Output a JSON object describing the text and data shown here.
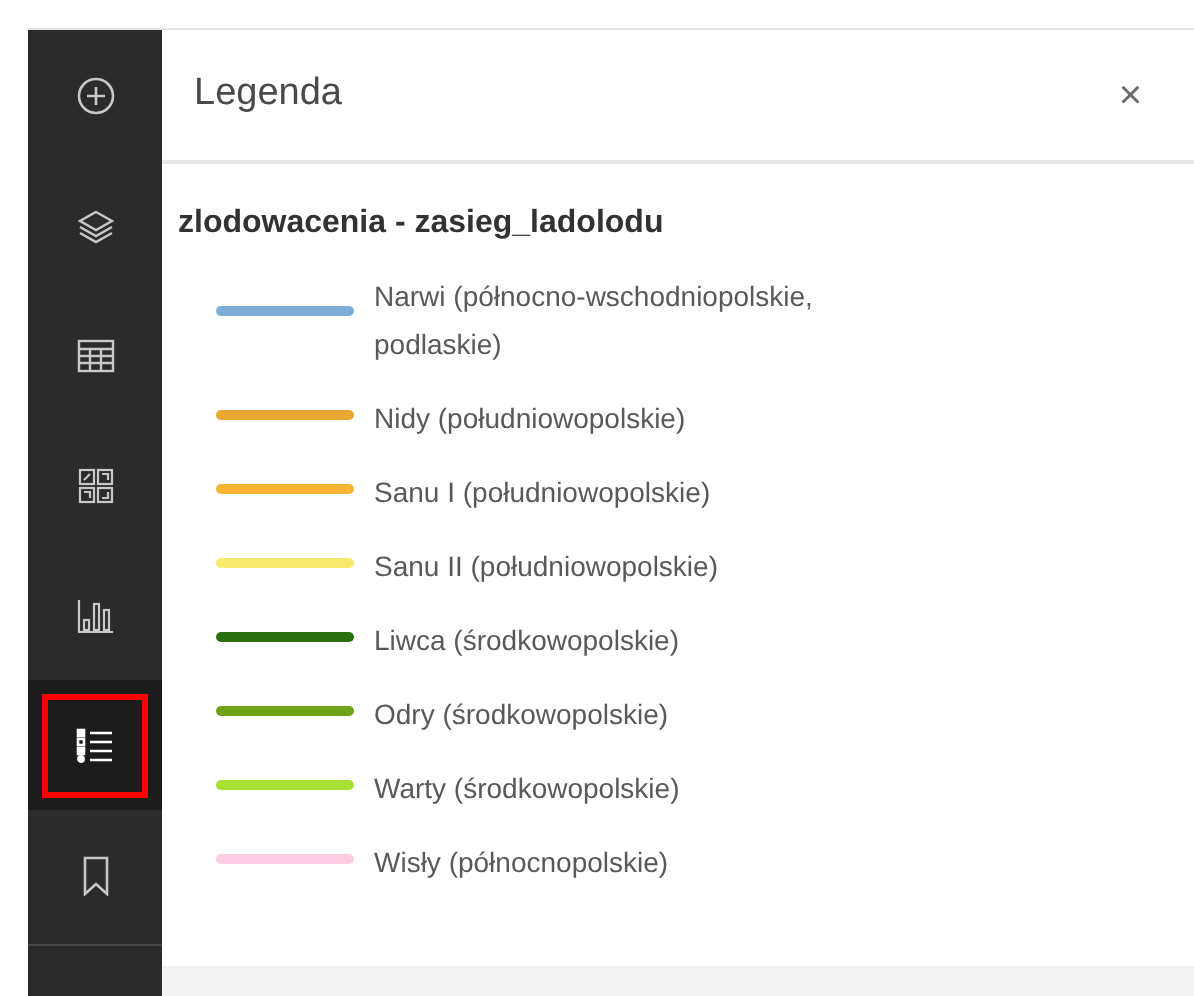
{
  "sidebar": {
    "items": [
      {
        "kind": "add",
        "selected": false
      },
      {
        "kind": "layers",
        "selected": false
      },
      {
        "kind": "table",
        "selected": false
      },
      {
        "kind": "grid",
        "selected": false
      },
      {
        "kind": "chart",
        "selected": false
      },
      {
        "kind": "legend",
        "selected": true
      },
      {
        "kind": "bookmark",
        "selected": false
      }
    ]
  },
  "panel": {
    "title": "Legenda",
    "close": "×"
  },
  "legend": {
    "layer_title": "zlodowacenia - zasieg_ladolodu",
    "items": [
      {
        "label": "Narwi (północno-wschodniopolskie, podlaskie)",
        "color": "#7eaed8"
      },
      {
        "label": "Nidy (południowopolskie)",
        "color": "#eaa731"
      },
      {
        "label": "Sanu I (południowopolskie)",
        "color": "#f8b534"
      },
      {
        "label": "Sanu II (południowopolskie)",
        "color": "#f8e96c"
      },
      {
        "label": "Liwca (środkowopolskie)",
        "color": "#2a7012"
      },
      {
        "label": "Odry (środkowopolskie)",
        "color": "#6ea31a"
      },
      {
        "label": "Warty (środkowopolskie)",
        "color": "#a6e234"
      },
      {
        "label": "Wisły (północnopolskie)",
        "color": "#fccde2"
      }
    ]
  }
}
